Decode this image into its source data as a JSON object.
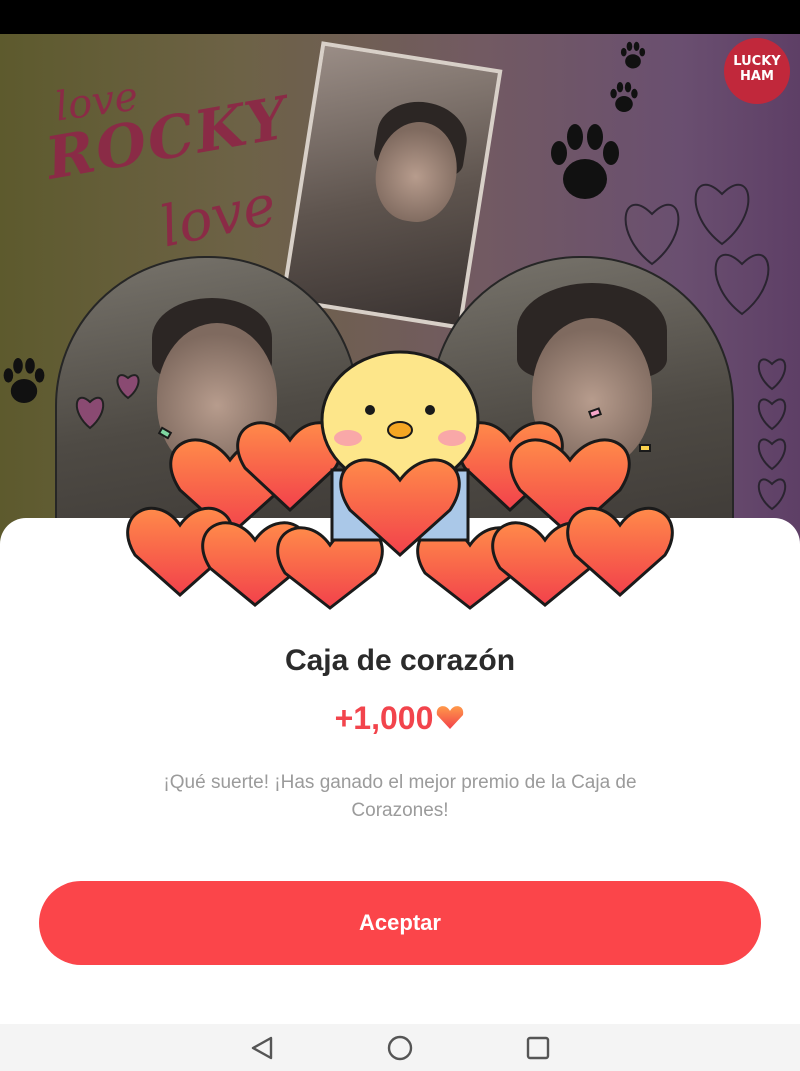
{
  "background": {
    "scribbles": [
      "love",
      "ROCKY",
      "love"
    ],
    "badge_text": [
      "LUCKY",
      "HAM"
    ]
  },
  "dialog": {
    "title": "Caja de corazón",
    "reward_amount": "+1,000",
    "reward_icon": "heart-icon",
    "message": "¡Qué suerte! ¡Has ganado el mejor premio de la Caja de Corazones!",
    "accept_label": "Aceptar",
    "accent_color": "#fb454a"
  },
  "navigation": {
    "back_icon": "back-triangle-icon",
    "home_icon": "home-circle-icon",
    "recents_icon": "recents-square-icon"
  }
}
